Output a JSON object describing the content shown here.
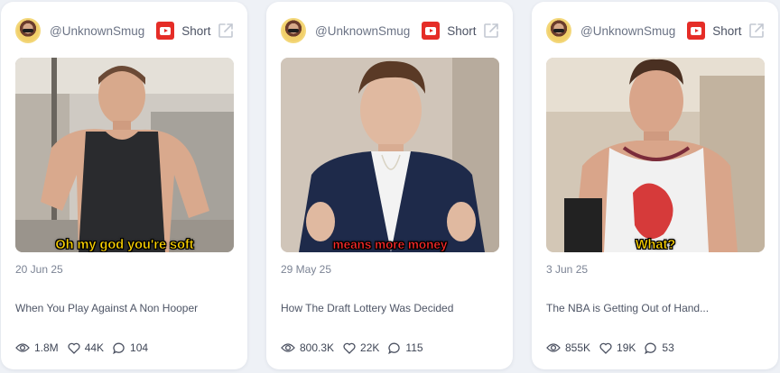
{
  "colors": {
    "youtube_red": "#e52d27",
    "caption_yellow": "#ffd400",
    "caption_red": "#ff2a2a"
  },
  "cards": [
    {
      "channel": "@UnknownSmug",
      "platform_icon": "youtube-icon",
      "type": "Short",
      "caption": "Oh my god you're soft",
      "date": "20 Jun 25",
      "title": "When You Play Against A Non Hooper",
      "views": "1.8M",
      "likes": "44K",
      "comments": "104"
    },
    {
      "channel": "@UnknownSmug",
      "platform_icon": "youtube-icon",
      "type": "Short",
      "caption": "means more money",
      "date": "29 May 25",
      "title": "How The Draft Lottery Was Decided",
      "views": "800.3K",
      "likes": "22K",
      "comments": "115"
    },
    {
      "channel": "@UnknownSmug",
      "platform_icon": "youtube-icon",
      "type": "Short",
      "caption": "What?",
      "date": "3 Jun 25",
      "title": "The NBA is Getting Out of Hand...",
      "views": "855K",
      "likes": "19K",
      "comments": "53"
    }
  ]
}
